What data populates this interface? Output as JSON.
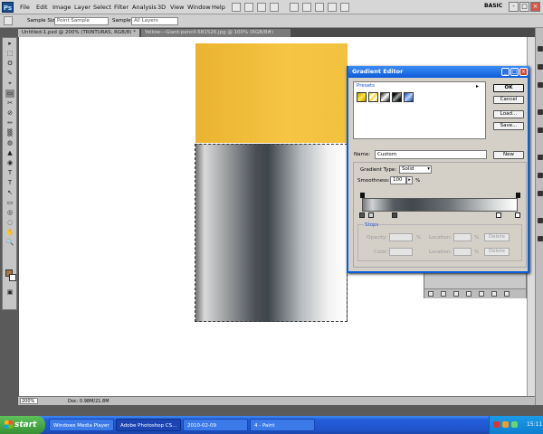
{
  "app": {
    "logo": "Ps",
    "menu": [
      "File",
      "Edit",
      "Image",
      "Layer",
      "Select",
      "Filter",
      "Analysis",
      "3D",
      "View",
      "Window",
      "Help"
    ],
    "workspace": "BASIC",
    "window_buttons": [
      "-",
      "□",
      "×"
    ]
  },
  "options_bar": {
    "sample_size_label": "Sample Size:",
    "sample_size_value": "Point Sample",
    "sample_label": "Sample:",
    "sample_value": "All Layers"
  },
  "document_tabs": [
    {
      "label": "Untitled-1.psd @ 200% (TRINTURAS, RGB/8) *",
      "active": true
    },
    {
      "label": "Yellow---Giant-pencil-581526.jpg @ 100% (RGB/8#)",
      "active": false
    }
  ],
  "toolbox": {
    "tools": [
      "▸",
      "⬚",
      "ʘ",
      "✎",
      "⌖",
      "▭",
      "✂",
      "⊘",
      "✏",
      "▒",
      "◍",
      "▲",
      "◉",
      "T",
      "↖",
      "▭",
      "✋",
      "🔍"
    ],
    "foreground_color": "#a8763e",
    "background_color": "#ffffff"
  },
  "status_bar": {
    "zoom": "200%",
    "doc_size": "Doc: 0.98M/21.8M"
  },
  "gradient_editor": {
    "title": "Gradient Editor",
    "presets_label": "Presets",
    "presets_menu": "▸",
    "buttons": {
      "ok": "OK",
      "cancel": "Cancel",
      "load": "Load...",
      "save": "Save...",
      "new": "New"
    },
    "name_label": "Name:",
    "name_value": "Custom",
    "gradient_type_label": "Gradient Type:",
    "gradient_type_value": "Solid",
    "smoothness_label": "Smoothness:",
    "smoothness_value": "100",
    "smoothness_unit": "%",
    "stops_label": "Stops",
    "opacity_label": "Opacity:",
    "color_label": "Color:",
    "location_label": "Location:",
    "percent": "%",
    "delete_label": "Delete"
  },
  "taskbar": {
    "start_label": "start",
    "tasks": [
      "Windows Media Player",
      "Adobe Photoshop CS...",
      "2010-02-09",
      "4 - Paint"
    ],
    "clock": "15:11"
  }
}
